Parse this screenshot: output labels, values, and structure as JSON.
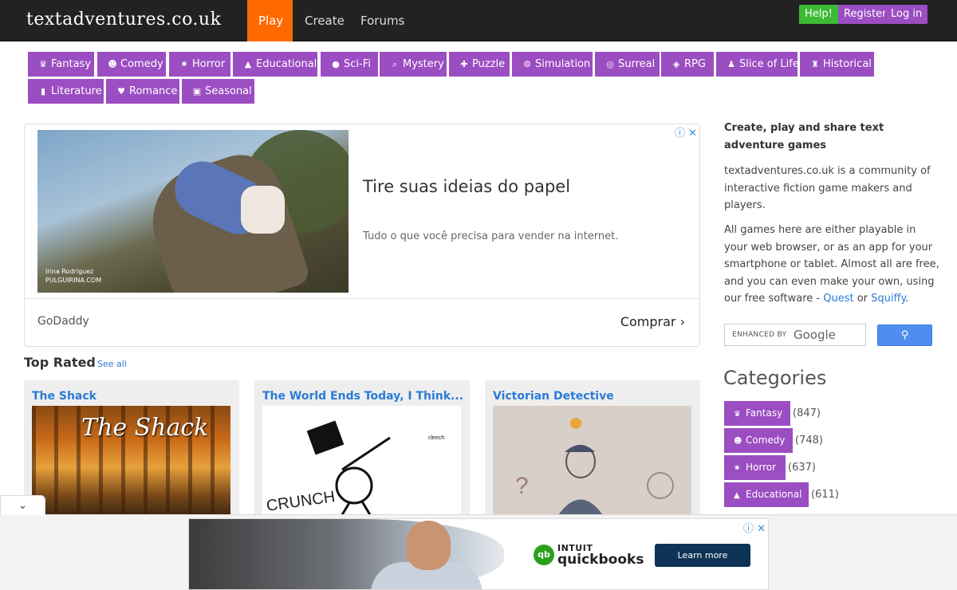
{
  "header": {
    "logo": "textadventures.co.uk",
    "nav": [
      "Play",
      "Create",
      "Forums"
    ],
    "buttons": {
      "help": "Help!",
      "register": "Register",
      "login": "Log in"
    }
  },
  "category_chips": [
    {
      "label": "Fantasy",
      "icon": "crown-icon"
    },
    {
      "label": "Comedy",
      "icon": "smile-icon"
    },
    {
      "label": "Horror",
      "icon": "spider-icon"
    },
    {
      "label": "Educational",
      "icon": "graduation-cap-icon"
    },
    {
      "label": "Sci-Fi",
      "icon": "alien-icon"
    },
    {
      "label": "Mystery",
      "icon": "magnifier-icon"
    },
    {
      "label": "Puzzle",
      "icon": "puzzle-icon"
    },
    {
      "label": "Simulation",
      "icon": "cogs-icon"
    },
    {
      "label": "Surreal",
      "icon": "swirl-icon"
    },
    {
      "label": "RPG",
      "icon": "dice-icon"
    },
    {
      "label": "Slice of Life",
      "icon": "walking-icon"
    },
    {
      "label": "Historical",
      "icon": "chess-rook-icon"
    },
    {
      "label": "Literature",
      "icon": "book-icon"
    },
    {
      "label": "Romance",
      "icon": "heart-icon"
    },
    {
      "label": "Seasonal",
      "icon": "gift-icon"
    }
  ],
  "ad": {
    "caption_line1": "Irina Rodriguez",
    "caption_line2": "PULGUIRINA.COM",
    "headline": "Tire suas ideias do papel",
    "subtext": "Tudo o que você precisa para vender na internet.",
    "brand": "GoDaddy",
    "cta": "Comprar"
  },
  "top_rated": {
    "title": "Top Rated",
    "see_all": "See all",
    "games": [
      {
        "title": "The Shack",
        "thumb_text": "The Shack"
      },
      {
        "title": "The World Ends Today, I Think...",
        "thumb_text": "CRUNCH"
      },
      {
        "title": "Victorian Detective"
      }
    ]
  },
  "sidebar": {
    "heading": "Create, play and share text adventure games",
    "p1": "textadventures.co.uk is a community of interactive fiction game makers and players.",
    "p2_before": "All games here are either playable in your web browser, or as an app for your smartphone or tablet. Almost all are free, and you can even make your own, using our free software - ",
    "p2_quest": "Quest",
    "p2_or": " or ",
    "p2_squiffy": "Squiffy",
    "p2_end": ".",
    "search_enhanced": "ENHANCED BY",
    "search_google": "Google",
    "categories_title": "Categories",
    "categories": [
      {
        "label": "Fantasy",
        "count": "(847)"
      },
      {
        "label": "Comedy",
        "count": "(748)"
      },
      {
        "label": "Horror",
        "count": "(637)"
      },
      {
        "label": "Educational",
        "count": "(611)"
      }
    ]
  },
  "bottom_ad": {
    "logo_mark": "qb",
    "brand_top": "INTUIT",
    "brand": "quickbooks",
    "cta": "Learn more"
  },
  "colors": {
    "accent_orange": "#ff6a00",
    "category_purple": "#9b4dc2",
    "help_green": "#3db935",
    "link_blue": "#2a7bd6"
  }
}
